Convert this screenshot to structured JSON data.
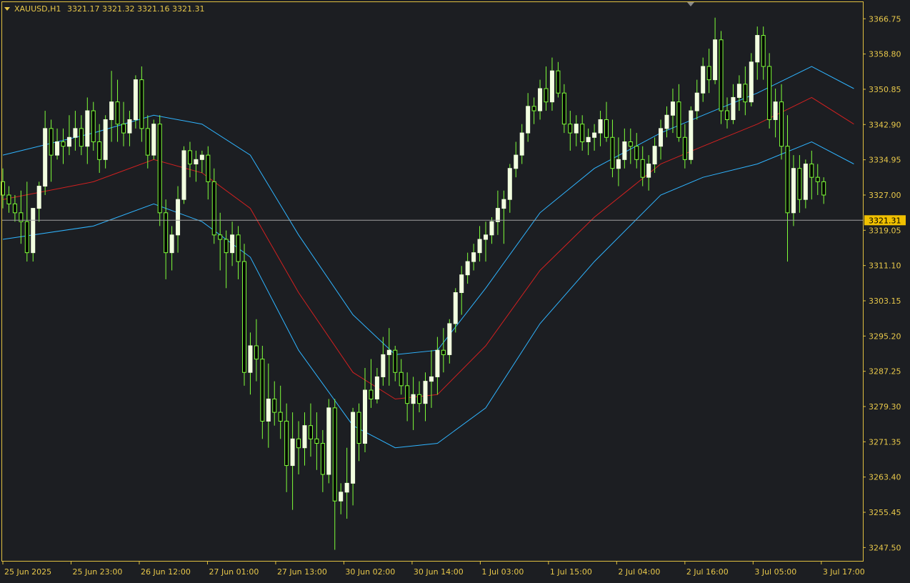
{
  "header": {
    "symbol_tf": "XAUUSD,H1",
    "ohlc": "3321.17 3321.32 3321.16 3321.31"
  },
  "colors": {
    "background": "#1c1e22",
    "frame": "#e0c040",
    "text": "#e8c84a",
    "bull_candle": "#f2ffe0",
    "wick": "#7fff3a",
    "band_outer": "#2fb4ff",
    "band_mid": "#d22020",
    "price_line": "#a0a0a0",
    "price_tag_bg": "#f0c000",
    "price_tag_text": "#000000"
  },
  "chart_data": {
    "type": "candlestick",
    "symbol": "XAUUSD",
    "timeframe": "H1",
    "ylim": [
      3244.5,
      3370.5
    ],
    "y_ticks": [
      "3366.75",
      "3358.80",
      "3350.85",
      "3342.90",
      "3334.95",
      "3327.00",
      "3319.05",
      "3311.10",
      "3303.15",
      "3295.20",
      "3287.25",
      "3279.30",
      "3271.35",
      "3263.40",
      "3255.45",
      "3247.50"
    ],
    "x_ticks": [
      "25 Jun 2025",
      "25 Jun 23:00",
      "26 Jun 12:00",
      "27 Jun 01:00",
      "27 Jun 13:00",
      "30 Jun 02:00",
      "30 Jun 14:00",
      "1 Jul 03:00",
      "1 Jul 15:00",
      "2 Jul 04:00",
      "2 Jul 16:00",
      "3 Jul 05:00",
      "3 Jul 17:00"
    ],
    "current_price": 3321.31,
    "current_price_label": "3321.31",
    "candles_ohlc": [
      [
        3330,
        3333,
        3324,
        3327
      ],
      [
        3327,
        3329,
        3323,
        3325
      ],
      [
        3325,
        3327,
        3321,
        3323
      ],
      [
        3323,
        3328,
        3316,
        3321
      ],
      [
        3321,
        3330,
        3312,
        3314
      ],
      [
        3314,
        3324,
        3312,
        3324
      ],
      [
        3324,
        3330,
        3321,
        3329
      ],
      [
        3329,
        3346,
        3327,
        3342
      ],
      [
        3342,
        3344,
        3330,
        3336
      ],
      [
        3336,
        3342,
        3335,
        3339
      ],
      [
        3339,
        3342,
        3334,
        3338
      ],
      [
        3338,
        3345,
        3336,
        3340
      ],
      [
        3340,
        3346,
        3337,
        3342
      ],
      [
        3342,
        3345,
        3336,
        3338
      ],
      [
        3338,
        3349,
        3334,
        3346
      ],
      [
        3346,
        3348,
        3337,
        3339
      ],
      [
        3339,
        3343,
        3332,
        3335
      ],
      [
        3335,
        3345,
        3333,
        3344
      ],
      [
        3344,
        3355,
        3339,
        3348
      ],
      [
        3348,
        3353,
        3339,
        3343
      ],
      [
        3343,
        3348,
        3338,
        3341
      ],
      [
        3341,
        3346,
        3338,
        3344
      ],
      [
        3344,
        3354,
        3342,
        3353
      ],
      [
        3353,
        3356,
        3339,
        3342
      ],
      [
        3342,
        3345,
        3333,
        3336
      ],
      [
        3336,
        3344,
        3335,
        3343
      ],
      [
        3343,
        3345,
        3320,
        3323
      ],
      [
        3323,
        3326,
        3308,
        3314
      ],
      [
        3314,
        3320,
        3310,
        3318
      ],
      [
        3318,
        3329,
        3314,
        3326
      ],
      [
        3326,
        3338,
        3325,
        3337
      ],
      [
        3337,
        3339,
        3331,
        3334
      ],
      [
        3334,
        3337,
        3330,
        3335
      ],
      [
        3335,
        3337,
        3332,
        3336
      ],
      [
        3336,
        3338,
        3326,
        3330
      ],
      [
        3330,
        3333,
        3316,
        3318
      ],
      [
        3318,
        3323,
        3310,
        3317
      ],
      [
        3317,
        3319,
        3306,
        3314
      ],
      [
        3314,
        3321,
        3311,
        3318
      ],
      [
        3318,
        3320,
        3308,
        3312
      ],
      [
        3312,
        3316,
        3284,
        3287
      ],
      [
        3287,
        3296,
        3282,
        3293
      ],
      [
        3293,
        3299,
        3285,
        3290
      ],
      [
        3290,
        3293,
        3272,
        3276
      ],
      [
        3276,
        3289,
        3270,
        3281
      ],
      [
        3281,
        3285,
        3275,
        3278
      ],
      [
        3278,
        3284,
        3272,
        3276
      ],
      [
        3276,
        3280,
        3260,
        3266
      ],
      [
        3266,
        3278,
        3256,
        3272
      ],
      [
        3272,
        3276,
        3264,
        3270
      ],
      [
        3270,
        3278,
        3266,
        3275
      ],
      [
        3275,
        3280,
        3268,
        3272
      ],
      [
        3272,
        3278,
        3265,
        3271
      ],
      [
        3271,
        3274,
        3260,
        3264
      ],
      [
        3264,
        3281,
        3262,
        3279
      ],
      [
        3279,
        3281,
        3247,
        3258
      ],
      [
        3258,
        3262,
        3255,
        3260
      ],
      [
        3260,
        3270,
        3254,
        3262
      ],
      [
        3262,
        3279,
        3257,
        3278
      ],
      [
        3278,
        3280,
        3267,
        3271
      ],
      [
        3271,
        3288,
        3269,
        3283
      ],
      [
        3283,
        3290,
        3279,
        3281
      ],
      [
        3281,
        3288,
        3280,
        3286
      ],
      [
        3286,
        3295,
        3284,
        3291
      ],
      [
        3291,
        3297,
        3284,
        3292
      ],
      [
        3292,
        3293,
        3285,
        3287
      ],
      [
        3287,
        3290,
        3282,
        3284
      ],
      [
        3284,
        3287,
        3276,
        3280
      ],
      [
        3280,
        3286,
        3274,
        3282
      ],
      [
        3282,
        3285,
        3278,
        3280
      ],
      [
        3280,
        3287,
        3276,
        3285
      ],
      [
        3285,
        3292,
        3279,
        3286
      ],
      [
        3286,
        3295,
        3282,
        3292
      ],
      [
        3292,
        3297,
        3287,
        3291
      ],
      [
        3291,
        3299,
        3289,
        3298
      ],
      [
        3298,
        3306,
        3296,
        3305
      ],
      [
        3305,
        3311,
        3300,
        3309
      ],
      [
        3309,
        3314,
        3307,
        3312
      ],
      [
        3312,
        3316,
        3310,
        3314
      ],
      [
        3314,
        3320,
        3312,
        3317
      ],
      [
        3317,
        3321,
        3312,
        3318
      ],
      [
        3318,
        3322,
        3316,
        3321
      ],
      [
        3321,
        3328,
        3318,
        3324
      ],
      [
        3324,
        3328,
        3316,
        3326
      ],
      [
        3326,
        3334,
        3323,
        3333
      ],
      [
        3333,
        3339,
        3331,
        3336
      ],
      [
        3336,
        3343,
        3334,
        3341
      ],
      [
        3341,
        3350,
        3339,
        3347
      ],
      [
        3347,
        3349,
        3343,
        3346
      ],
      [
        3346,
        3353,
        3344,
        3351
      ],
      [
        3351,
        3356,
        3346,
        3348
      ],
      [
        3348,
        3358,
        3346,
        3355
      ],
      [
        3355,
        3357,
        3349,
        3350
      ],
      [
        3350,
        3352,
        3341,
        3343
      ],
      [
        3343,
        3346,
        3337,
        3341
      ],
      [
        3341,
        3345,
        3338,
        3343
      ],
      [
        3343,
        3345,
        3337,
        3339
      ],
      [
        3339,
        3342,
        3336,
        3340
      ],
      [
        3340,
        3343,
        3337,
        3341
      ],
      [
        3341,
        3346,
        3338,
        3344
      ],
      [
        3344,
        3348,
        3339,
        3340
      ],
      [
        3340,
        3344,
        3331,
        3333
      ],
      [
        3333,
        3340,
        3329,
        3335
      ],
      [
        3335,
        3342,
        3333,
        3339
      ],
      [
        3339,
        3342,
        3334,
        3338
      ],
      [
        3338,
        3341,
        3333,
        3335
      ],
      [
        3335,
        3338,
        3329,
        3331
      ],
      [
        3331,
        3336,
        3328,
        3334
      ],
      [
        3334,
        3340,
        3332,
        3338
      ],
      [
        3338,
        3344,
        3335,
        3342
      ],
      [
        3342,
        3347,
        3340,
        3345
      ],
      [
        3345,
        3351,
        3341,
        3348
      ],
      [
        3348,
        3352,
        3339,
        3340
      ],
      [
        3340,
        3343,
        3333,
        3335
      ],
      [
        3335,
        3347,
        3334,
        3346
      ],
      [
        3346,
        3353,
        3344,
        3350
      ],
      [
        3350,
        3358,
        3348,
        3356
      ],
      [
        3356,
        3360,
        3350,
        3353
      ],
      [
        3353,
        3367,
        3352,
        3362
      ],
      [
        3362,
        3364,
        3343,
        3346
      ],
      [
        3346,
        3349,
        3342,
        3344
      ],
      [
        3344,
        3352,
        3343,
        3349
      ],
      [
        3349,
        3354,
        3346,
        3352
      ],
      [
        3352,
        3356,
        3345,
        3348
      ],
      [
        3348,
        3359,
        3347,
        3357
      ],
      [
        3357,
        3365,
        3353,
        3363
      ],
      [
        3363,
        3365,
        3353,
        3356
      ],
      [
        3356,
        3359,
        3342,
        3344
      ],
      [
        3344,
        3351,
        3340,
        3348
      ],
      [
        3348,
        3352,
        3335,
        3338
      ],
      [
        3338,
        3345,
        3312,
        3323
      ],
      [
        3323,
        3336,
        3320,
        3333
      ],
      [
        3333,
        3336,
        3323,
        3326
      ],
      [
        3326,
        3335,
        3324,
        3334
      ],
      [
        3334,
        3337,
        3326,
        3331
      ],
      [
        3331,
        3334,
        3327,
        3330
      ],
      [
        3330,
        3331,
        3325,
        3327
      ]
    ],
    "series": [
      {
        "name": "upper band",
        "points": [
          [
            0,
            3336
          ],
          [
            15,
            3341
          ],
          [
            25,
            3345
          ],
          [
            33,
            3343
          ],
          [
            41,
            3336
          ],
          [
            49,
            3318
          ],
          [
            58,
            3300
          ],
          [
            65,
            3291
          ],
          [
            72,
            3292
          ],
          [
            80,
            3306
          ],
          [
            89,
            3323
          ],
          [
            98,
            3333
          ],
          [
            109,
            3341
          ],
          [
            116,
            3345
          ],
          [
            125,
            3350
          ],
          [
            134,
            3356
          ],
          [
            141,
            3351
          ]
        ]
      },
      {
        "name": "middle band",
        "points": [
          [
            0,
            3326
          ],
          [
            15,
            3330
          ],
          [
            25,
            3335
          ],
          [
            33,
            3332
          ],
          [
            41,
            3324
          ],
          [
            49,
            3305
          ],
          [
            58,
            3287
          ],
          [
            65,
            3281
          ],
          [
            72,
            3282
          ],
          [
            80,
            3293
          ],
          [
            89,
            3310
          ],
          [
            98,
            3322
          ],
          [
            109,
            3334
          ],
          [
            116,
            3338
          ],
          [
            125,
            3343
          ],
          [
            134,
            3349
          ],
          [
            141,
            3343
          ]
        ]
      },
      {
        "name": "lower band",
        "points": [
          [
            0,
            3317
          ],
          [
            15,
            3320
          ],
          [
            25,
            3325
          ],
          [
            33,
            3321
          ],
          [
            41,
            3313
          ],
          [
            49,
            3292
          ],
          [
            58,
            3275
          ],
          [
            65,
            3270
          ],
          [
            72,
            3271
          ],
          [
            80,
            3279
          ],
          [
            89,
            3298
          ],
          [
            98,
            3312
          ],
          [
            109,
            3327
          ],
          [
            116,
            3331
          ],
          [
            125,
            3334
          ],
          [
            134,
            3339
          ],
          [
            141,
            3334
          ]
        ]
      }
    ]
  }
}
